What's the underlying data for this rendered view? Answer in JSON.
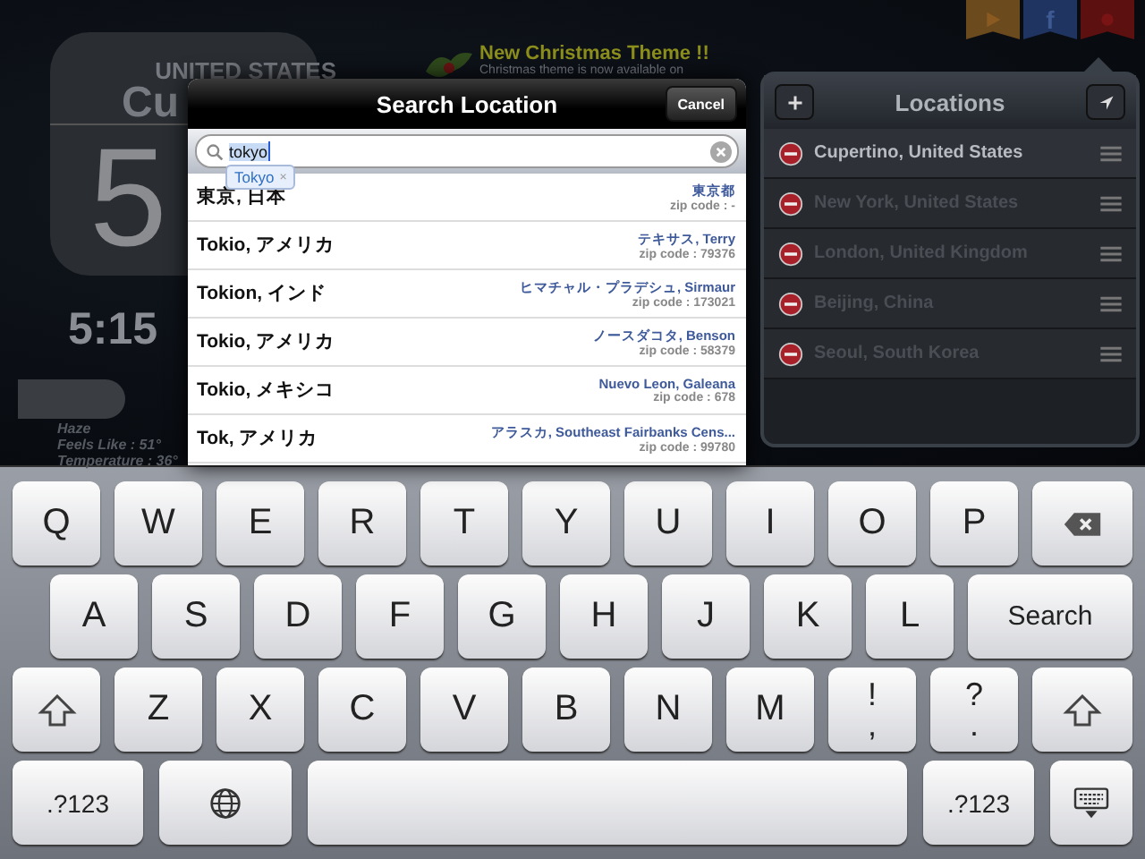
{
  "background": {
    "country": "UNITED STATES",
    "city": "Cu",
    "big_digit": "5",
    "time": "5:15",
    "conditions": [
      "Haze",
      "Feels Like : 51°",
      "Temperature : 36°"
    ],
    "news": {
      "title": "New Christmas Theme !!",
      "text": "Christmas theme is now available on"
    },
    "ribbons": [
      {
        "kind": "video"
      },
      {
        "kind": "facebook",
        "label": "f"
      },
      {
        "kind": "dot"
      }
    ]
  },
  "search_dialog": {
    "title": "Search Location",
    "cancel": "Cancel",
    "query": "tokyo",
    "suggestion": "Tokyo",
    "suggestion_close": "×",
    "results": [
      {
        "name": "東京, 日本",
        "region": "東京都",
        "zip": "zip code : -"
      },
      {
        "name": "Tokio, アメリカ",
        "region": "テキサス, Terry",
        "zip": "zip code : 79376"
      },
      {
        "name": "Tokion, インド",
        "region": "ヒマチャル・プラデシュ, Sirmaur",
        "zip": "zip code : 173021"
      },
      {
        "name": "Tokio, アメリカ",
        "region": "ノースダコタ, Benson",
        "zip": "zip code : 58379"
      },
      {
        "name": "Tokio, メキシコ",
        "region": "Nuevo Leon, Galeana",
        "zip": "zip code : 678"
      },
      {
        "name": "Tok, アメリカ",
        "region": "アラスカ, Southeast Fairbanks Cens...",
        "zip": "zip code : 99780"
      }
    ]
  },
  "locations": {
    "title": "Locations",
    "items": [
      {
        "name": "Cupertino, United States",
        "selected": true
      },
      {
        "name": "New York, United States",
        "selected": false
      },
      {
        "name": "London, United Kingdom",
        "selected": false
      },
      {
        "name": "Beijing, China",
        "selected": false
      },
      {
        "name": "Seoul, South Korea",
        "selected": false
      }
    ]
  },
  "keyboard": {
    "rows": [
      {
        "keys": [
          {
            "kind": "letter",
            "label": "Q"
          },
          {
            "kind": "letter",
            "label": "W"
          },
          {
            "kind": "letter",
            "label": "E"
          },
          {
            "kind": "letter",
            "label": "R"
          },
          {
            "kind": "letter",
            "label": "T"
          },
          {
            "kind": "letter",
            "label": "Y"
          },
          {
            "kind": "letter",
            "label": "U"
          },
          {
            "kind": "letter",
            "label": "I"
          },
          {
            "kind": "letter",
            "label": "O"
          },
          {
            "kind": "letter",
            "label": "P"
          },
          {
            "kind": "backspace"
          }
        ]
      },
      {
        "keys": [
          {
            "kind": "letter",
            "label": "A"
          },
          {
            "kind": "letter",
            "label": "S"
          },
          {
            "kind": "letter",
            "label": "D"
          },
          {
            "kind": "letter",
            "label": "F"
          },
          {
            "kind": "letter",
            "label": "G"
          },
          {
            "kind": "letter",
            "label": "H"
          },
          {
            "kind": "letter",
            "label": "J"
          },
          {
            "kind": "letter",
            "label": "K"
          },
          {
            "kind": "letter",
            "label": "L"
          },
          {
            "kind": "search",
            "label": "Search"
          }
        ]
      },
      {
        "keys": [
          {
            "kind": "shift"
          },
          {
            "kind": "letter",
            "label": "Z"
          },
          {
            "kind": "letter",
            "label": "X"
          },
          {
            "kind": "letter",
            "label": "C"
          },
          {
            "kind": "letter",
            "label": "V"
          },
          {
            "kind": "letter",
            "label": "B"
          },
          {
            "kind": "letter",
            "label": "N"
          },
          {
            "kind": "letter",
            "label": "M"
          },
          {
            "kind": "dual",
            "top": "!",
            "bottom": ","
          },
          {
            "kind": "dual",
            "top": "?",
            "bottom": "."
          },
          {
            "kind": "shift"
          }
        ]
      },
      {
        "keys": [
          {
            "kind": "mode",
            "label": ".?123"
          },
          {
            "kind": "globe"
          },
          {
            "kind": "space"
          },
          {
            "kind": "mode",
            "label": ".?123"
          },
          {
            "kind": "hide"
          }
        ]
      }
    ]
  }
}
